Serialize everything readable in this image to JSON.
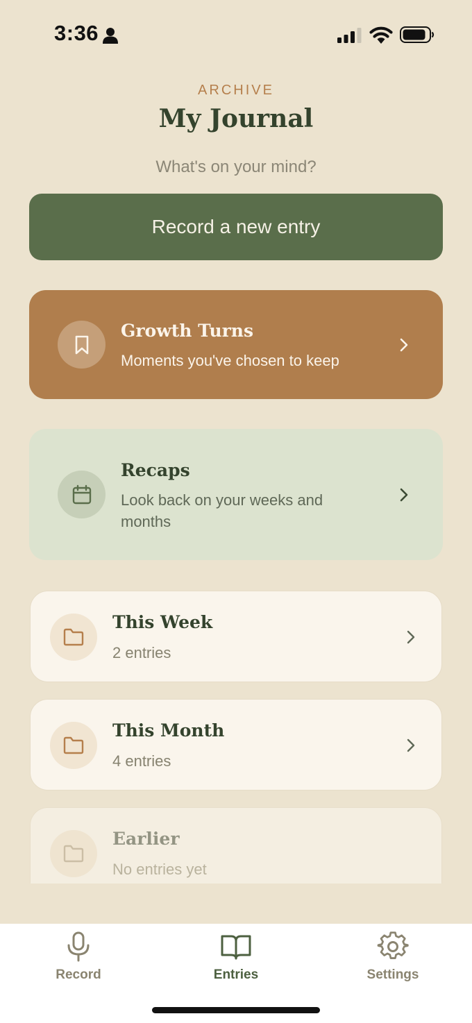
{
  "status_bar": {
    "time": "3:36"
  },
  "header": {
    "overline": "ARCHIVE",
    "title": "My Journal",
    "subtitle": "What's on your mind?"
  },
  "primary_action": {
    "label": "Record a new entry",
    "color": "#5a6e4b"
  },
  "cards": {
    "growth": {
      "title": "Growth Turns",
      "description": "Moments you've chosen to keep",
      "icon": "bookmark-icon",
      "color": "#b07e4d"
    },
    "recaps": {
      "title": "Recaps",
      "description": "Look back on your weeks and months",
      "icon": "calendar-icon",
      "color": "#dce3cf"
    }
  },
  "folders": [
    {
      "title": "This Week",
      "count": "2 entries",
      "icon": "folder-icon"
    },
    {
      "title": "This Month",
      "count": "4 entries",
      "icon": "folder-icon"
    },
    {
      "title": "Earlier",
      "count": "No entries yet",
      "icon": "folder-icon"
    }
  ],
  "tab_bar": {
    "tabs": [
      {
        "label": "Record",
        "icon": "microphone-icon",
        "active": false
      },
      {
        "label": "Entries",
        "icon": "open-book-icon",
        "active": true
      },
      {
        "label": "Settings",
        "icon": "gear-icon",
        "active": false
      }
    ]
  },
  "colors": {
    "background": "#ece3cf",
    "accent_text": "#b57f4c",
    "heading": "#34432d"
  }
}
